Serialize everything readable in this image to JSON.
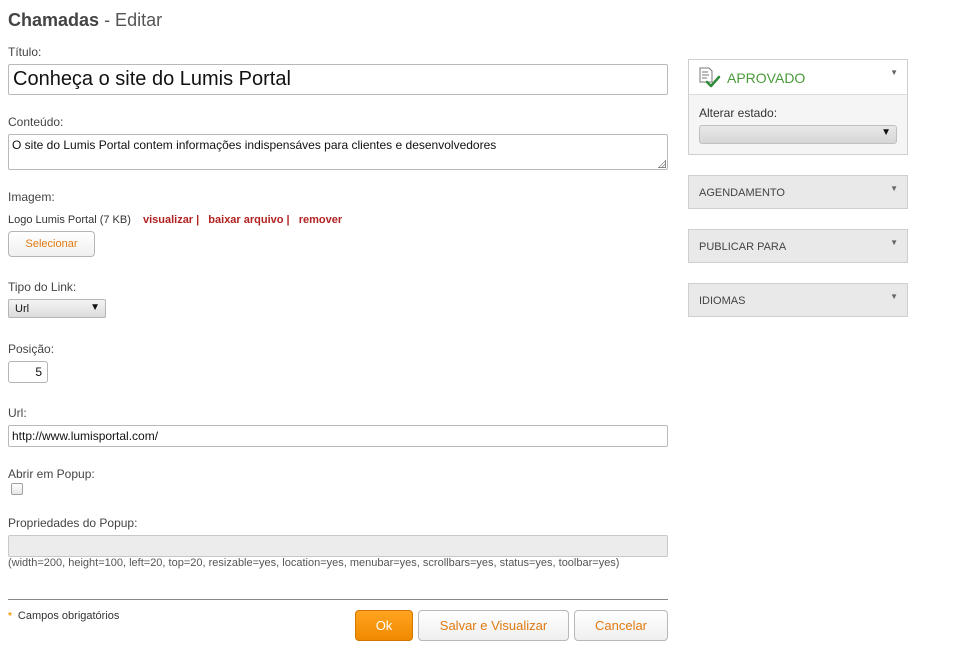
{
  "header": {
    "title": "Chamadas",
    "subtitle": "- Editar"
  },
  "form": {
    "titulo_label": "Título:",
    "titulo_value": "Conheça o site do Lumis Portal",
    "conteudo_label": "Conteúdo:",
    "conteudo_value": "O site do Lumis Portal contem informações indispensáves para clientes e desenvolvedores",
    "imagem_label": "Imagem:",
    "imagem_file": "Logo Lumis Portal (7 KB)",
    "imagem_visualizar": "visualizar |",
    "imagem_baixar": "baixar arquivo |",
    "imagem_remover": "remover",
    "selecionar_label": "Selecionar",
    "tipo_link_label": "Tipo do Link:",
    "tipo_link_value": "Url",
    "posicao_label": "Posição:",
    "posicao_value": "5",
    "url_label": "Url:",
    "url_value": "http://www.lumisportal.com/",
    "popup_label": "Abrir em Popup:",
    "popup_checked": false,
    "popup_props_label": "Propriedades do Popup:",
    "popup_props_value": "",
    "popup_props_hint": "(width=200, height=100, left=20, top=20, resizable=yes, location=yes, menubar=yes, scrollbars=yes, status=yes, toolbar=yes)"
  },
  "footer": {
    "required_note": "Campos obrigatórios",
    "ok_label": "Ok",
    "salvar_label": "Salvar e Visualizar",
    "cancelar_label": "Cancelar"
  },
  "sidebar": {
    "state_title": "APROVADO",
    "state_change_label": "Alterar estado:",
    "state_select_value": "",
    "panels": [
      {
        "title": "AGENDAMENTO"
      },
      {
        "title": "PUBLICAR PARA"
      },
      {
        "title": "IDIOMAS"
      }
    ]
  },
  "colors": {
    "accent_orange": "#f08a00",
    "link_red": "#b22222",
    "approved_green": "#4a9b3a"
  },
  "icons": [
    "document-check-icon",
    "collapse-arrow-icon",
    "dropdown-arrow-icon",
    "resize-grip-icon"
  ]
}
